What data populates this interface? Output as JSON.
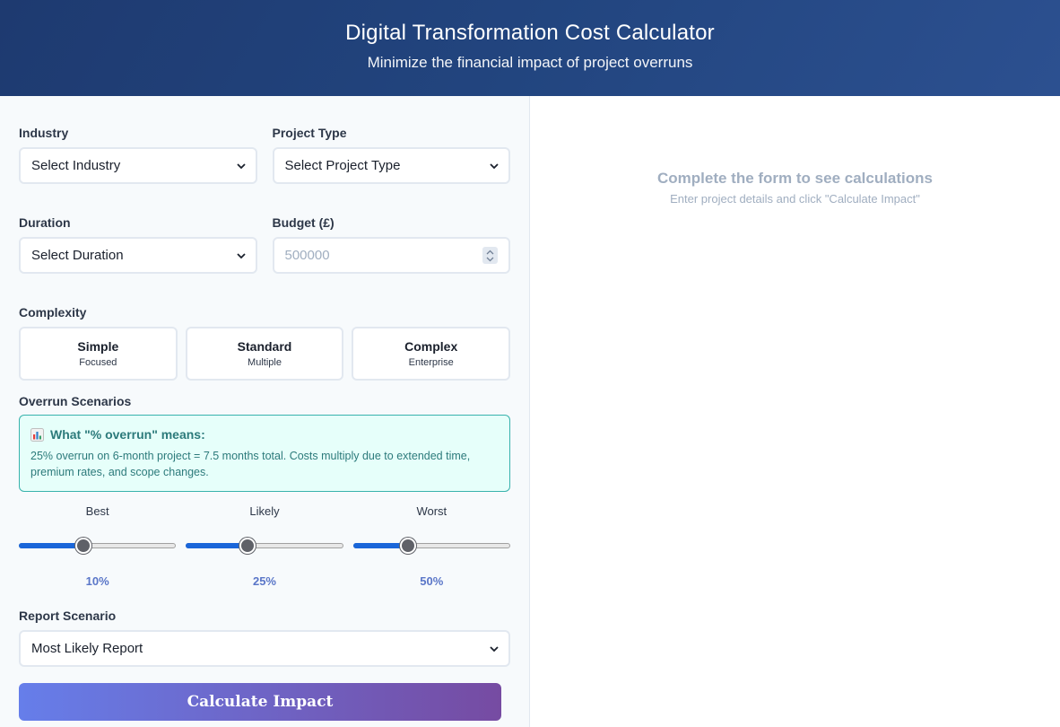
{
  "header": {
    "title": "Digital Transformation Cost Calculator",
    "subtitle": "Minimize the financial impact of project overruns"
  },
  "form": {
    "industry": {
      "label": "Industry",
      "value": "Select Industry"
    },
    "project_type": {
      "label": "Project Type",
      "value": "Select Project Type"
    },
    "duration": {
      "label": "Duration",
      "value": "Select Duration"
    },
    "budget": {
      "label": "Budget (£)",
      "placeholder": "500000"
    },
    "complexity": {
      "label": "Complexity",
      "options": [
        {
          "title": "Simple",
          "subtitle": "Focused"
        },
        {
          "title": "Standard",
          "subtitle": "Multiple"
        },
        {
          "title": "Complex",
          "subtitle": "Enterprise"
        }
      ]
    },
    "overrun": {
      "label": "Overrun Scenarios",
      "info_title": "What \"% overrun\" means:",
      "info_icon": "bar-chart-icon",
      "info_text": "25% overrun on 6-month project = 7.5 months total. Costs multiply due to extended time, premium rates, and scope changes.",
      "sliders": [
        {
          "label": "Best",
          "value_text": "10%",
          "fraction": 0.41
        },
        {
          "label": "Likely",
          "value_text": "25%",
          "fraction": 0.39
        },
        {
          "label": "Worst",
          "value_text": "50%",
          "fraction": 0.35
        }
      ]
    },
    "report_scenario": {
      "label": "Report Scenario",
      "value": "Most Likely Report"
    },
    "submit_label": "Calculate Impact"
  },
  "results": {
    "empty_title": "Complete the form to see calculations",
    "empty_text": "Enter project details and click \"Calculate Impact\""
  },
  "colors": {
    "header_bg": "#1e3a70",
    "accent_start": "#667eea",
    "accent_end": "#764ba2",
    "info_border": "#38b2ac",
    "slider_fill": "#1a66d9"
  }
}
